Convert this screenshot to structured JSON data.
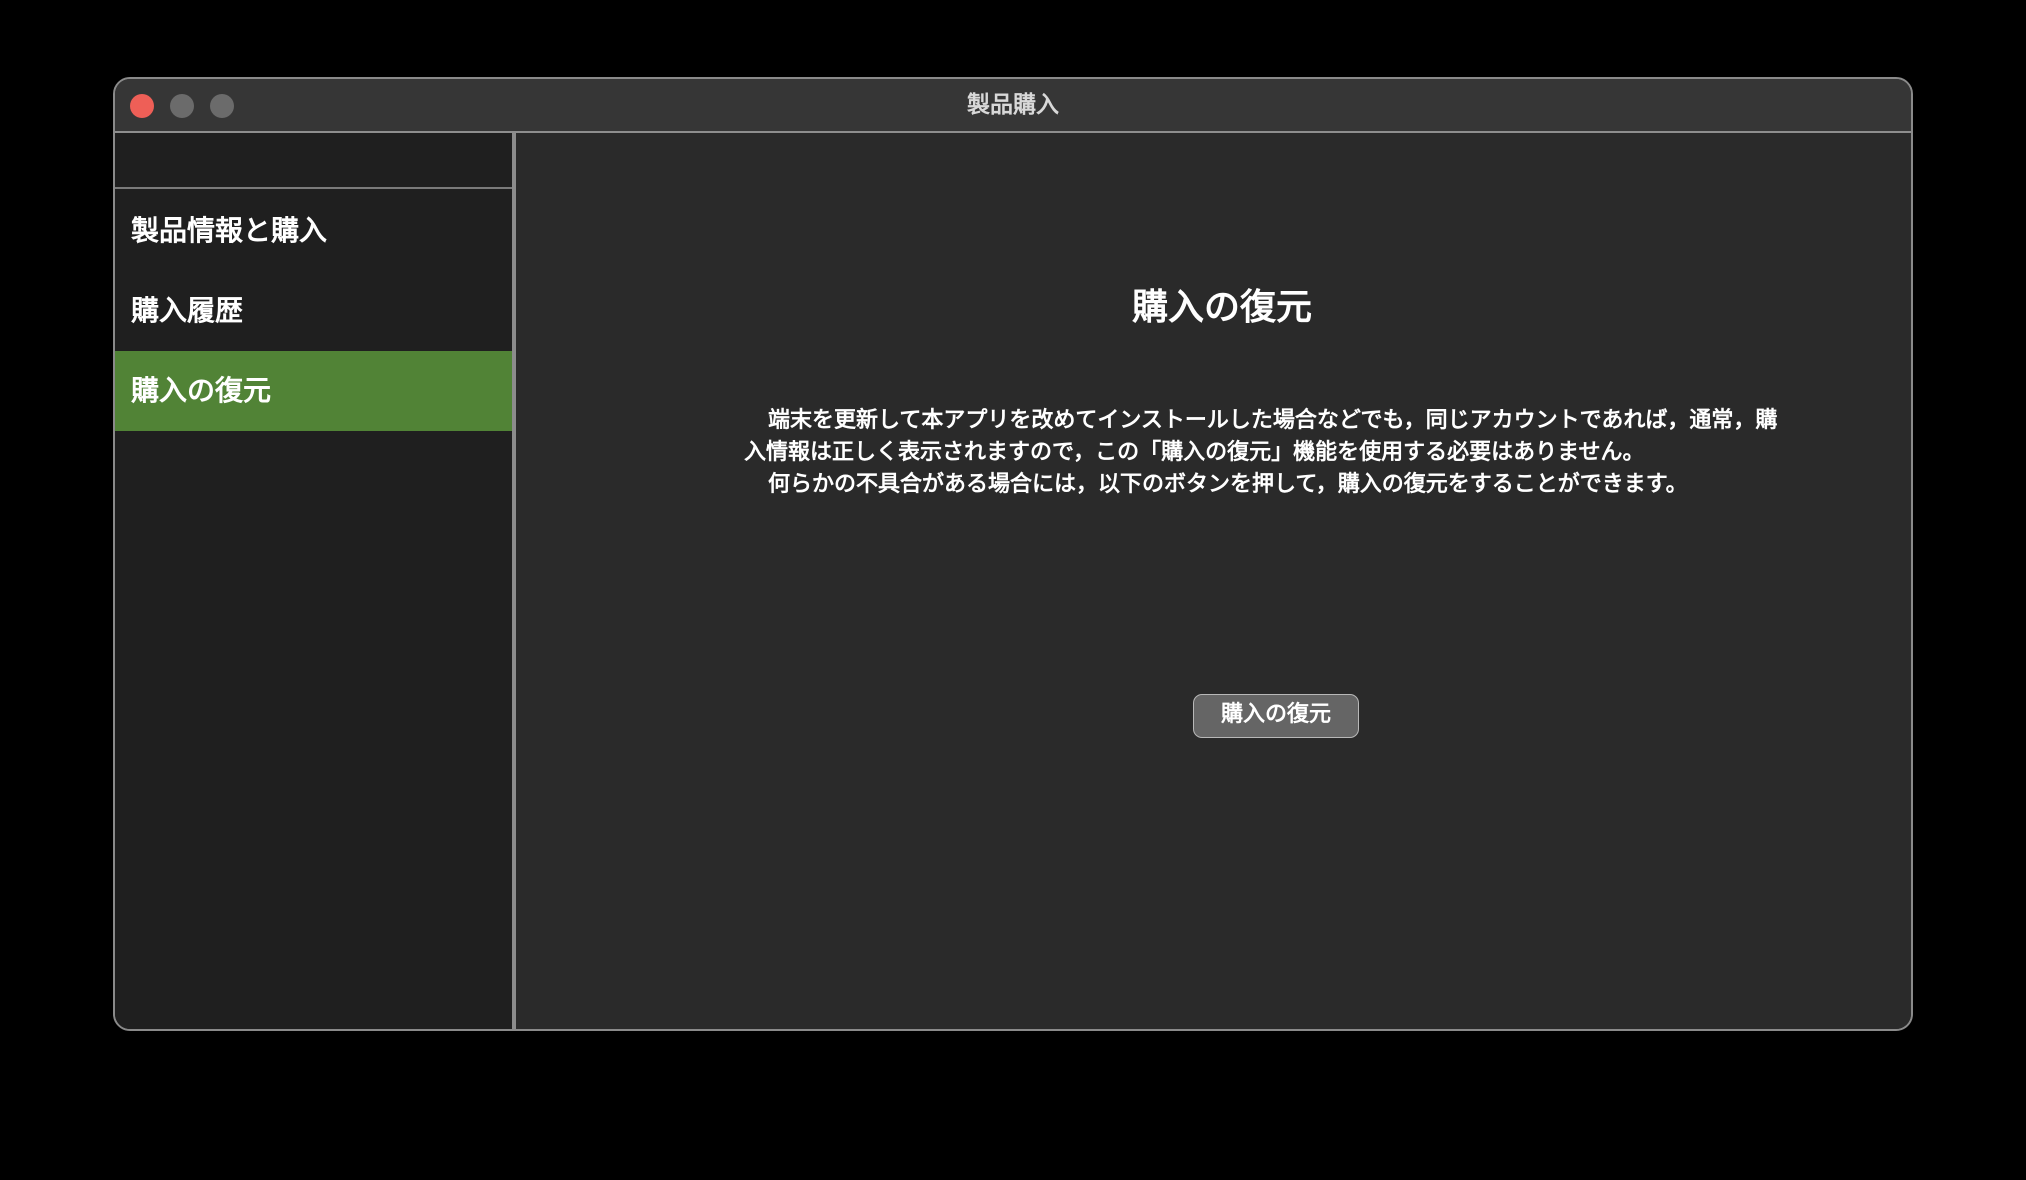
{
  "window": {
    "title": "製品購入"
  },
  "sidebar": {
    "items": [
      {
        "label": "製品情報と購入",
        "active": false
      },
      {
        "label": "購入履歴",
        "active": false
      },
      {
        "label": "購入の復元",
        "active": true
      }
    ]
  },
  "main": {
    "heading": "購入の復元",
    "paragraphs": [
      "端末を更新して本アプリを改めてインストールした場合などでも，同じアカウントであれば，通常，購入情報は正しく表示されますので，この「購入の復元」機能を使用する必要はありません。",
      "何らかの不具合がある場合には，以下のボタンを押して，購入の復元をすることができます。"
    ],
    "restore_button_label": "購入の復元"
  },
  "colors": {
    "active_item": "#518336",
    "close_button": "#ee5f57",
    "window_bg": "#2a2a2a",
    "sidebar_bg": "#1f1f1f"
  }
}
